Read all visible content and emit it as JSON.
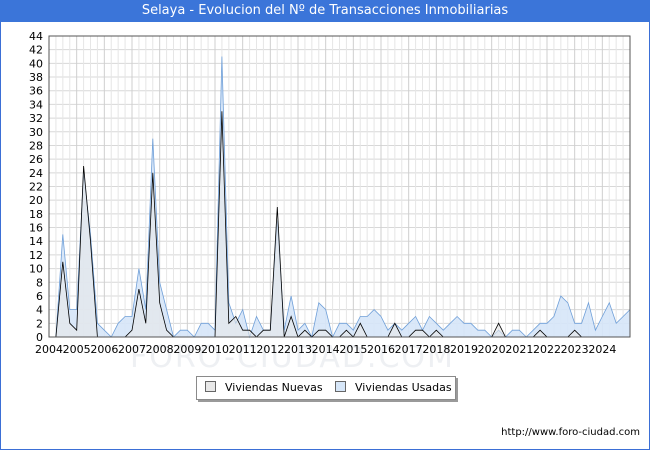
{
  "header": {
    "title": "Selaya - Evolucion del Nº de Transacciones Inmobiliarias"
  },
  "footer": {
    "url": "http://www.foro-ciudad.com"
  },
  "watermark": "FORO-CIUDAD.COM",
  "chart_data": {
    "type": "area",
    "title": "Selaya - Evolucion del Nº de Transacciones Inmobiliarias",
    "xlabel": "",
    "ylabel": "",
    "x_ticks": [
      "2004",
      "2005",
      "2006",
      "2007",
      "2008",
      "2009",
      "2010",
      "2011",
      "2012",
      "2013",
      "2014",
      "2015",
      "2016",
      "2017",
      "2018",
      "2019",
      "2020",
      "2021",
      "2022",
      "2023",
      "2024"
    ],
    "xlim": [
      2004.0,
      2025.0
    ],
    "ylim": [
      0,
      44
    ],
    "y_ticks": [
      0,
      2,
      4,
      6,
      8,
      10,
      12,
      14,
      16,
      18,
      20,
      22,
      24,
      26,
      28,
      30,
      32,
      34,
      36,
      38,
      40,
      42,
      44
    ],
    "grid": true,
    "legend_position": "bottom-center",
    "series": [
      {
        "name": "Viviendas Nuevas",
        "color": "#000000",
        "fill": "#e8e8e8",
        "x": [
          2004.25,
          2004.5,
          2004.75,
          2005.0,
          2005.25,
          2005.5,
          2005.75,
          2006.0,
          2006.25,
          2006.5,
          2006.75,
          2007.0,
          2007.25,
          2007.5,
          2007.75,
          2008.0,
          2008.25,
          2008.5,
          2008.75,
          2009.0,
          2009.25,
          2009.5,
          2009.75,
          2010.0,
          2010.25,
          2010.5,
          2010.75,
          2011.0,
          2011.25,
          2011.5,
          2011.75,
          2012.0,
          2012.25,
          2012.5,
          2012.75,
          2013.0,
          2013.25,
          2013.5,
          2013.75,
          2014.0,
          2014.25,
          2014.5,
          2014.75,
          2015.0,
          2015.25,
          2015.5,
          2015.75,
          2016.0,
          2016.25,
          2016.5,
          2016.75,
          2017.0,
          2017.25,
          2017.5,
          2017.75,
          2018.0,
          2018.25,
          2018.5,
          2018.75,
          2019.0,
          2019.25,
          2019.5,
          2019.75,
          2020.0,
          2020.25,
          2020.5,
          2020.75,
          2021.0,
          2021.25,
          2021.5,
          2021.75,
          2022.0,
          2022.25,
          2022.5,
          2022.75,
          2023.0,
          2023.25,
          2023.5,
          2023.75,
          2024.0,
          2024.25,
          2024.5,
          2024.75,
          2025.0
        ],
        "values": [
          0,
          11,
          2,
          1,
          25,
          14,
          0,
          0,
          0,
          0,
          0,
          1,
          7,
          2,
          24,
          5,
          1,
          0,
          0,
          0,
          0,
          0,
          0,
          0,
          33,
          2,
          3,
          1,
          1,
          0,
          1,
          1,
          19,
          0,
          3,
          0,
          1,
          0,
          1,
          1,
          0,
          0,
          1,
          0,
          2,
          0,
          0,
          0,
          0,
          2,
          0,
          0,
          1,
          1,
          0,
          1,
          0,
          0,
          0,
          0,
          0,
          0,
          0,
          0,
          2,
          0,
          0,
          0,
          0,
          0,
          1,
          0,
          0,
          0,
          0,
          1,
          0,
          0,
          0,
          0,
          0,
          0,
          0,
          0
        ]
      },
      {
        "name": "Viviendas Usadas",
        "color": "#6f9fd8",
        "fill": "#d6e6f8",
        "x": [
          2004.25,
          2004.5,
          2004.75,
          2005.0,
          2005.25,
          2005.5,
          2005.75,
          2006.0,
          2006.25,
          2006.5,
          2006.75,
          2007.0,
          2007.25,
          2007.5,
          2007.75,
          2008.0,
          2008.25,
          2008.5,
          2008.75,
          2009.0,
          2009.25,
          2009.5,
          2009.75,
          2010.0,
          2010.25,
          2010.5,
          2010.75,
          2011.0,
          2011.25,
          2011.5,
          2011.75,
          2012.0,
          2012.25,
          2012.5,
          2012.75,
          2013.0,
          2013.25,
          2013.5,
          2013.75,
          2014.0,
          2014.25,
          2014.5,
          2014.75,
          2015.0,
          2015.25,
          2015.5,
          2015.75,
          2016.0,
          2016.25,
          2016.5,
          2016.75,
          2017.0,
          2017.25,
          2017.5,
          2017.75,
          2018.0,
          2018.25,
          2018.5,
          2018.75,
          2019.0,
          2019.25,
          2019.5,
          2019.75,
          2020.0,
          2020.25,
          2020.5,
          2020.75,
          2021.0,
          2021.25,
          2021.5,
          2021.75,
          2022.0,
          2022.25,
          2022.5,
          2022.75,
          2023.0,
          2023.25,
          2023.5,
          2023.75,
          2024.0,
          2024.25,
          2024.5,
          2024.75,
          2025.0
        ],
        "values": [
          0,
          15,
          4,
          4,
          24,
          15,
          2,
          1,
          0,
          2,
          3,
          3,
          10,
          4,
          29,
          8,
          4,
          0,
          1,
          1,
          0,
          2,
          2,
          1,
          41,
          5,
          2,
          4,
          0,
          3,
          1,
          1,
          17,
          1,
          6,
          1,
          2,
          0,
          5,
          4,
          0,
          2,
          2,
          1,
          3,
          3,
          4,
          3,
          1,
          2,
          1,
          2,
          3,
          1,
          3,
          2,
          1,
          2,
          3,
          2,
          2,
          1,
          1,
          0,
          1,
          0,
          1,
          1,
          0,
          1,
          2,
          2,
          3,
          6,
          5,
          2,
          2,
          5,
          1,
          3,
          5,
          2,
          3,
          4
        ]
      }
    ]
  }
}
